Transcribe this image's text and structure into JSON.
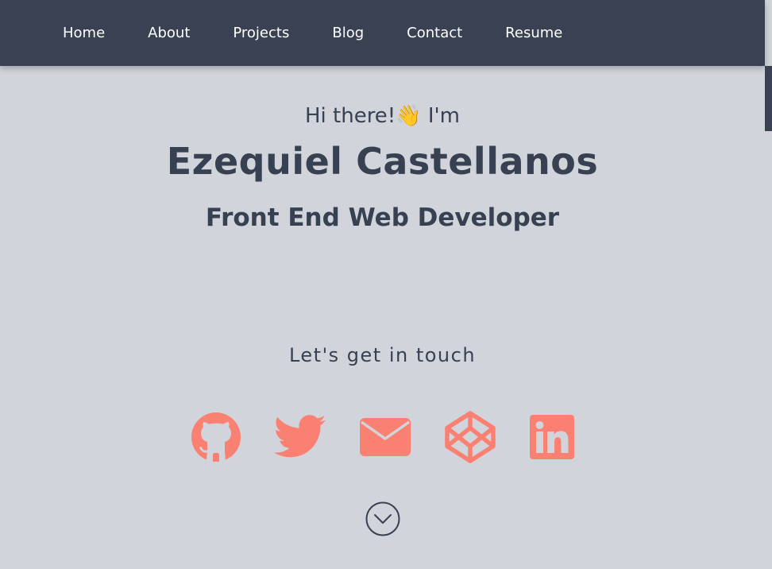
{
  "nav": {
    "items": [
      {
        "label": "Home"
      },
      {
        "label": "About"
      },
      {
        "label": "Projects"
      },
      {
        "label": "Blog"
      },
      {
        "label": "Contact"
      },
      {
        "label": "Resume"
      }
    ]
  },
  "hero": {
    "greeting": "Hi there!👋 I'm",
    "name": "Ezequiel Castellanos",
    "role": "Front End Web Developer"
  },
  "contact": {
    "heading": "Let's get in touch",
    "icons": [
      "github-icon",
      "twitter-icon",
      "email-icon",
      "codepen-icon",
      "linkedin-icon"
    ],
    "icon_color": "#fa8072"
  },
  "colors": {
    "navbar": "#394153",
    "background": "#d2d4db",
    "text": "#374151",
    "accent": "#fa8072"
  }
}
